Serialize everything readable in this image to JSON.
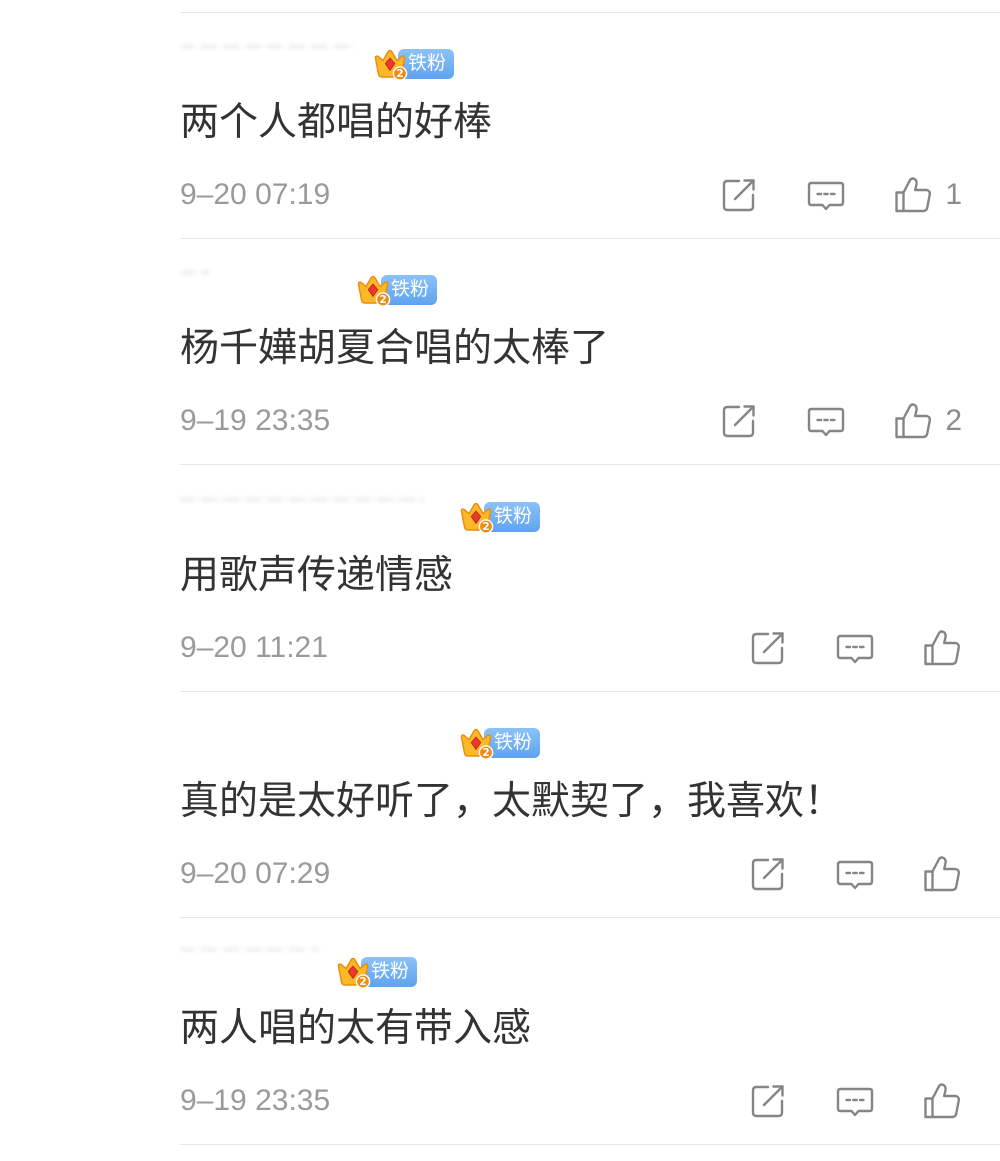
{
  "colors": {
    "background": "#ffffff",
    "text": "#333333",
    "time": "#9a9a9a",
    "icon": "#858585",
    "count": "#8c8c8c",
    "divider": "#e6e6e6",
    "fan_badge_blue": "#5ea3ef",
    "crown_gold": "#fbb829",
    "crown_gem": "#e8392b"
  },
  "icons": {
    "badge": "crown-level-icon",
    "share": "share-icon",
    "comment": "comment-icon",
    "like": "thumbs-up-icon"
  },
  "comments": [
    {
      "badge": {
        "level": "2",
        "label": "铁粉"
      },
      "text": "两个人都唱的好棒",
      "time": "9–20 07:19",
      "like_count": "1"
    },
    {
      "badge": {
        "level": "2",
        "label": "铁粉"
      },
      "text": "杨千嬅胡夏合唱的太棒了",
      "time": "9–19 23:35",
      "like_count": "2"
    },
    {
      "badge": {
        "level": "2",
        "label": "铁粉"
      },
      "text": "用歌声传递情感",
      "time": "9–20 11:21"
    },
    {
      "badge": {
        "level": "2",
        "label": "铁粉"
      },
      "text": "真的是太好听了，太默契了，我喜欢！",
      "time": "9–20 07:29"
    },
    {
      "badge": {
        "level": "2",
        "label": "铁粉"
      },
      "text": "两人唱的太有带入感",
      "time": "9–19 23:35"
    }
  ]
}
